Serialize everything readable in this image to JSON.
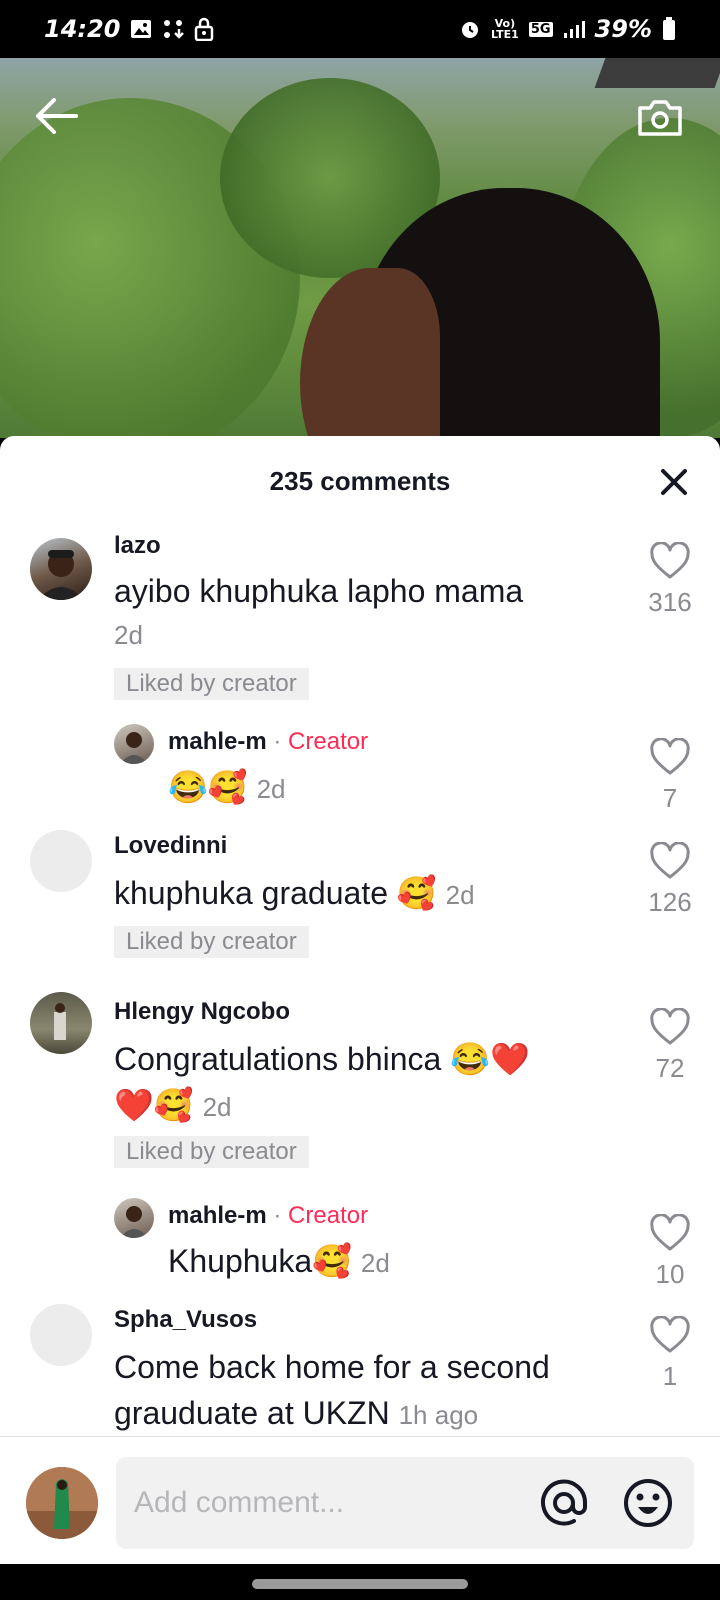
{
  "status_bar": {
    "time": "14:20",
    "battery": "39%",
    "network": "5G"
  },
  "video": {
    "back_icon": "arrow-left-icon",
    "camera_icon": "camera-icon"
  },
  "sheet": {
    "title": "235 comments",
    "close_icon": "close-icon"
  },
  "comments": [
    {
      "username": "lazo",
      "text": "ayibo khuphuka lapho mama",
      "time": "2d",
      "liked_by_creator": "Liked by creator",
      "likes": "316"
    },
    {
      "username": "mahle-m",
      "separator": "·",
      "creator_label": "Creator",
      "text": "😂🥰",
      "time": "2d",
      "likes": "7"
    },
    {
      "username": "Lovedinni",
      "text": "khuphuka graduate 🥰",
      "time": "2d",
      "liked_by_creator": "Liked by creator",
      "likes": "126"
    },
    {
      "username": "Hlengy Ngcobo",
      "text_line1": "Congratulations bhinca 😂❤️",
      "text_line2": "❤️🥰",
      "time": "2d",
      "liked_by_creator": "Liked by creator",
      "likes": "72"
    },
    {
      "username": "mahle-m",
      "separator": "·",
      "creator_label": "Creator",
      "text": "Khuphuka🥰",
      "time": "2d",
      "likes": "10"
    },
    {
      "username": "Spha_Vusos",
      "text_line1": "Come back home for a second",
      "text_line2": "grauduate at UKZN",
      "time": "1h ago",
      "likes": "1"
    }
  ],
  "input": {
    "placeholder": "Add comment...",
    "mention_icon": "at-sign-icon",
    "emoji_icon": "emoji-smiley-icon"
  }
}
